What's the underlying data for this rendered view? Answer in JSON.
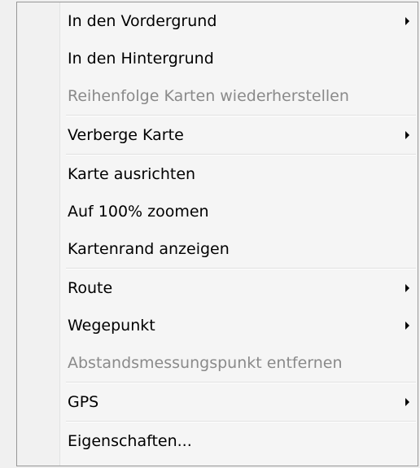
{
  "menu": {
    "groups": [
      {
        "items": [
          {
            "label": "In den Vordergrund",
            "submenu": true,
            "disabled": false
          },
          {
            "label": "In den Hintergrund",
            "submenu": false,
            "disabled": false
          },
          {
            "label": "Reihenfolge Karten wiederherstellen",
            "submenu": false,
            "disabled": true
          }
        ]
      },
      {
        "items": [
          {
            "label": "Verberge Karte",
            "submenu": true,
            "disabled": false
          }
        ]
      },
      {
        "items": [
          {
            "label": "Karte ausrichten",
            "submenu": false,
            "disabled": false
          },
          {
            "label": "Auf 100% zoomen",
            "submenu": false,
            "disabled": false
          },
          {
            "label": "Kartenrand anzeigen",
            "submenu": false,
            "disabled": false
          }
        ]
      },
      {
        "items": [
          {
            "label": "Route",
            "submenu": true,
            "disabled": false
          },
          {
            "label": "Wegepunkt",
            "submenu": true,
            "disabled": false
          },
          {
            "label": "Abstandsmessungspunkt entfernen",
            "submenu": false,
            "disabled": true
          }
        ]
      },
      {
        "items": [
          {
            "label": "GPS",
            "submenu": true,
            "disabled": false
          }
        ]
      },
      {
        "items": [
          {
            "label": "Eigenschaften...",
            "submenu": false,
            "disabled": false
          }
        ]
      }
    ]
  },
  "colors": {
    "text": "#000000",
    "disabled_text": "#8a8a8a",
    "background": "#f5f5f5",
    "border": "#979797"
  }
}
